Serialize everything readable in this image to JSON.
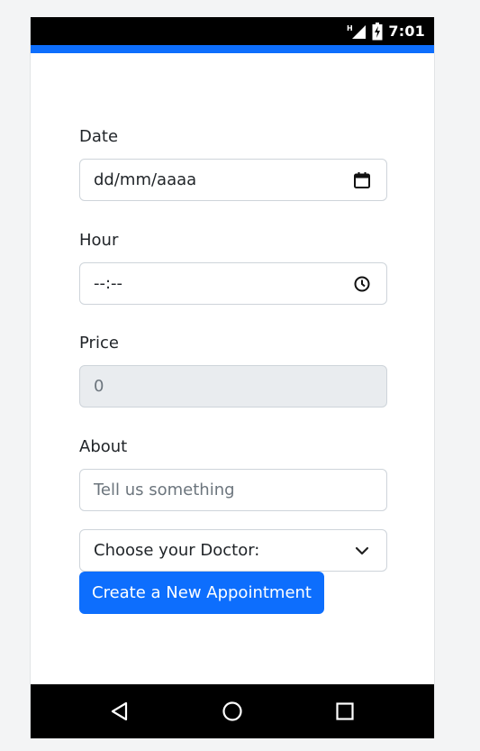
{
  "status_bar": {
    "network_icon": "signal-h-icon",
    "battery_icon": "battery-charging-icon",
    "time": "7:01"
  },
  "form": {
    "date": {
      "label": "Date",
      "value": "dd/mm/aaaa",
      "icon": "calendar-icon"
    },
    "hour": {
      "label": "Hour",
      "value": "--:--",
      "icon": "clock-icon"
    },
    "price": {
      "label": "Price",
      "value": "0"
    },
    "about": {
      "label": "About",
      "placeholder": "Tell us something"
    },
    "doctor_select": {
      "selected": "Choose your Doctor:",
      "icon": "chevron-down-icon"
    },
    "submit_label": "Create a New Appointment"
  },
  "nav_bar": {
    "back_icon": "back-triangle-icon",
    "home_icon": "home-circle-icon",
    "recents_icon": "recents-square-icon"
  },
  "colors": {
    "accent": "#0d6efd",
    "disabled_bg": "#e9ecef",
    "border": "#ced4da"
  }
}
